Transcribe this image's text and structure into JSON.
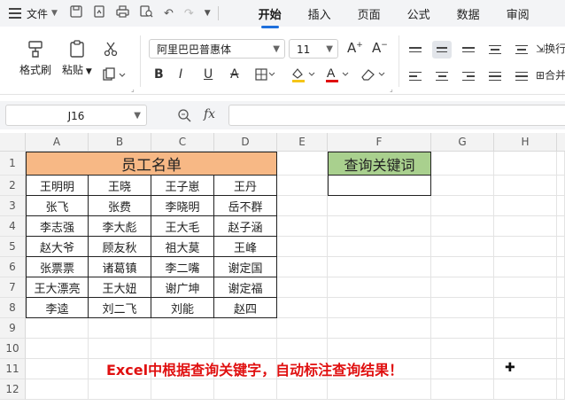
{
  "menu": {
    "file_label": "文件",
    "tabs": [
      "开始",
      "插入",
      "页面",
      "公式",
      "数据",
      "审阅"
    ],
    "active_tab": "开始"
  },
  "ribbon": {
    "format_painter": "格式刷",
    "paste": "粘贴",
    "font_name": "阿里巴巴普惠体",
    "font_size": "11",
    "wrap_label": "换行",
    "merge_label": "合并"
  },
  "formula_bar": {
    "name_box": "J16",
    "fx_label": "fx",
    "value": ""
  },
  "sheet": {
    "columns": [
      "A",
      "B",
      "C",
      "D",
      "E",
      "F",
      "G",
      "H"
    ],
    "rows": [
      "1",
      "2",
      "3",
      "4",
      "5",
      "6",
      "7",
      "8",
      "9",
      "10",
      "11",
      "12"
    ],
    "title": "员工名单",
    "names": [
      [
        "王明明",
        "王晓",
        "王子崽",
        "王丹"
      ],
      [
        "张飞",
        "张费",
        "李晓明",
        "岳不群"
      ],
      [
        "李志强",
        "李大彪",
        "王大毛",
        "赵子涵"
      ],
      [
        "赵大爷",
        "顾友秋",
        "祖大莫",
        "王峰"
      ],
      [
        "张票票",
        "诸葛镇",
        "李二嘴",
        "谢定国"
      ],
      [
        "王大漂亮",
        "王大妞",
        "谢广坤",
        "谢定福"
      ],
      [
        "李逵",
        "刘二飞",
        "刘能",
        "赵四"
      ]
    ],
    "keyword_header": "查询关键词",
    "keyword_value": "",
    "note": "Excel中根据查询关键字，自动标注查询结果！"
  },
  "colors": {
    "title_fill": "#f7b885",
    "keyword_fill": "#a9d08e",
    "note_color": "#e01010",
    "active_tab_underline": "#1e6fdc"
  }
}
